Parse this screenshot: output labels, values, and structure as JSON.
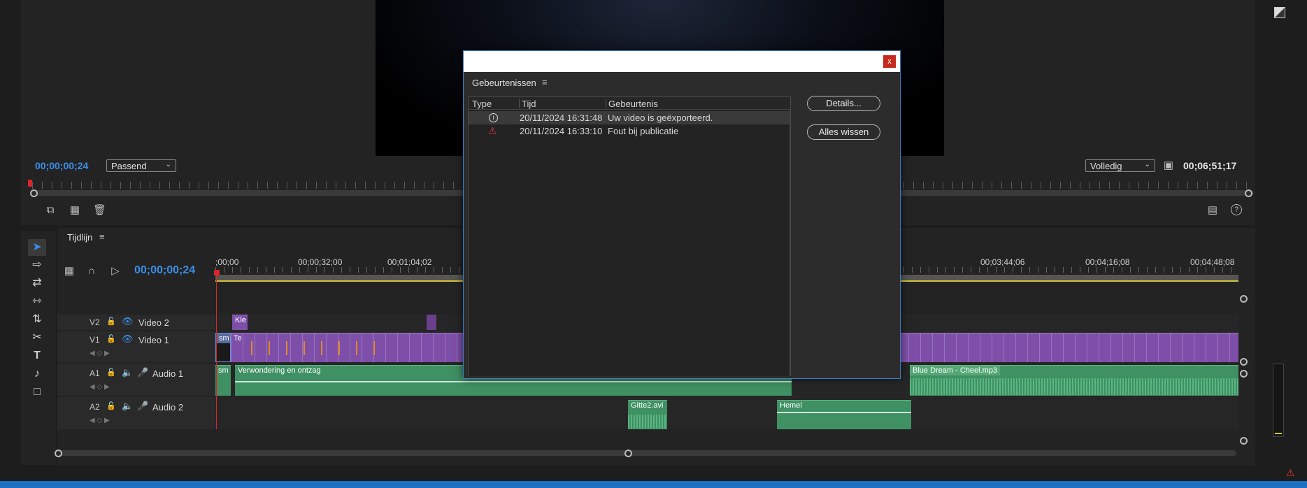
{
  "monitor": {
    "timecode_in": "00;00;00;24",
    "zoom": "Passend",
    "quality": "Volledig",
    "duration": "00;06;51;17"
  },
  "timeline": {
    "panel_title": "Tijdlijn",
    "timecode": "00;00;00;24",
    "ruler_labels": [
      ";00;00",
      "00;00;32;00",
      "00;01;04;02",
      "00;03;44;06",
      "00;04;16;08",
      "00;04;48;08"
    ],
    "tracks": {
      "v2": {
        "id": "V2",
        "name": "Video 2"
      },
      "v1": {
        "id": "V1",
        "name": "Video 1"
      },
      "a1": {
        "id": "A1",
        "name": "Audio 1"
      },
      "a2": {
        "id": "A2",
        "name": "Audio 2"
      }
    },
    "clips": {
      "v2_kle": "Kle",
      "v1_sm": "sm",
      "v1_te": "Te",
      "a1_sm": "sm",
      "a1_main": "Verwondering en ontzag",
      "a1_blue": "Blue Dream - Cheel.mp3",
      "a2_gitte": "Gitte2.avi",
      "a2_hemel": "Hemel"
    }
  },
  "dialog": {
    "title": "Gebeurtenissen",
    "close_label": "x",
    "columns": [
      "Type",
      "Tijd",
      "Gebeurtenis"
    ],
    "events": [
      {
        "type": "info-icon",
        "time": "20/11/2024 16:31:48",
        "message": "Uw video is geëxporteerd."
      },
      {
        "type": "warning-icon",
        "time": "20/11/2024 16:33:10",
        "message": "Fout bij publicatie"
      }
    ],
    "details_button": "Details...",
    "clear_button": "Alles wissen"
  },
  "colors": {
    "accent_blue": "#3b8fe8",
    "video_clip": "#7e4fa8",
    "audio_clip": "#3f9063",
    "playhead": "#d8262b",
    "warning": "#e03a3a"
  }
}
